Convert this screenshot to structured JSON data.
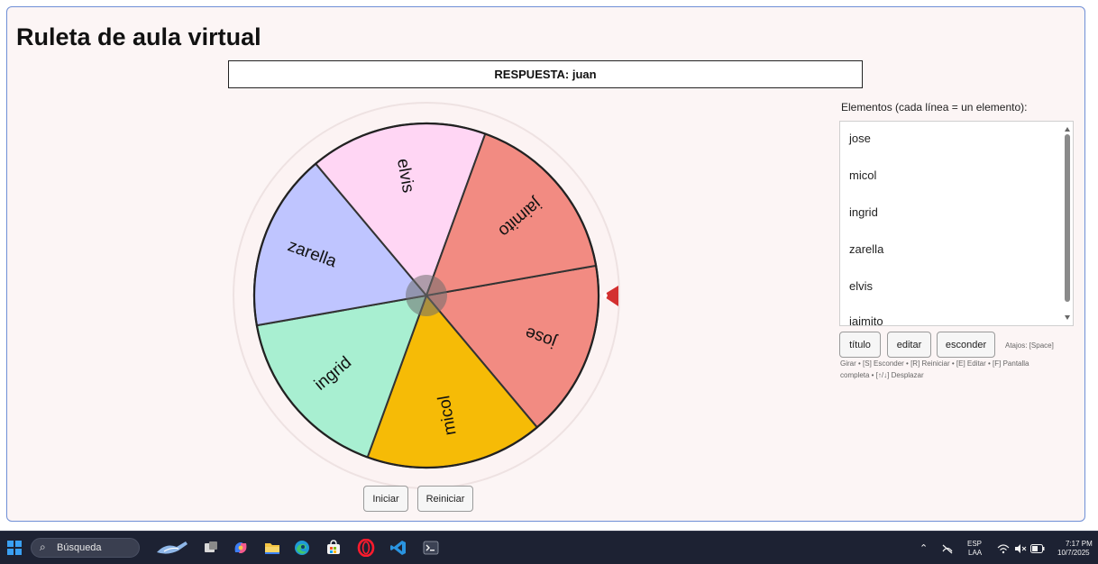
{
  "app": {
    "title": "Ruleta de aula virtual",
    "answer": "RESPUESTA: juan"
  },
  "wheel": {
    "segments": [
      {
        "label": "jose",
        "color": "#f28b82"
      },
      {
        "label": "micol",
        "color": "#f6bb06"
      },
      {
        "label": "ingrid",
        "color": "#a8efd1"
      },
      {
        "label": "zarella",
        "color": "#bfc5ff"
      },
      {
        "label": "elvis",
        "color": "#ffd6f4"
      },
      {
        "label": "jaimito",
        "color": "#f28b82"
      }
    ],
    "pointer_color": "#d32f2f"
  },
  "controls": {
    "start_label": "Iniciar",
    "reset_label": "Reiniciar"
  },
  "sidebar": {
    "list_label": "Elementos (cada línea = un elemento):",
    "items": [
      "jose",
      "micol",
      "ingrid",
      "zarella",
      "elvis",
      "jaimito"
    ],
    "buttons": {
      "title": "título",
      "edit": "editar",
      "hide": "esconder"
    },
    "shortcuts": {
      "line1": "Atajos: [Space]",
      "line2": "Girar • [S] Esconder • [R] Reiniciar • [E] Editar • [F] Pantalla",
      "line3": "completa • [↑/↓] Desplazar"
    }
  },
  "taskbar": {
    "search_placeholder": "Búsqueda",
    "lang_top": "ESP",
    "lang_bottom": "LAA",
    "time": "7:17 PM",
    "date": "10/7/2025",
    "apps": [
      "pen-app",
      "task-view",
      "copilot",
      "file-explorer",
      "edge",
      "store",
      "opera",
      "vscode",
      "terminal"
    ]
  }
}
